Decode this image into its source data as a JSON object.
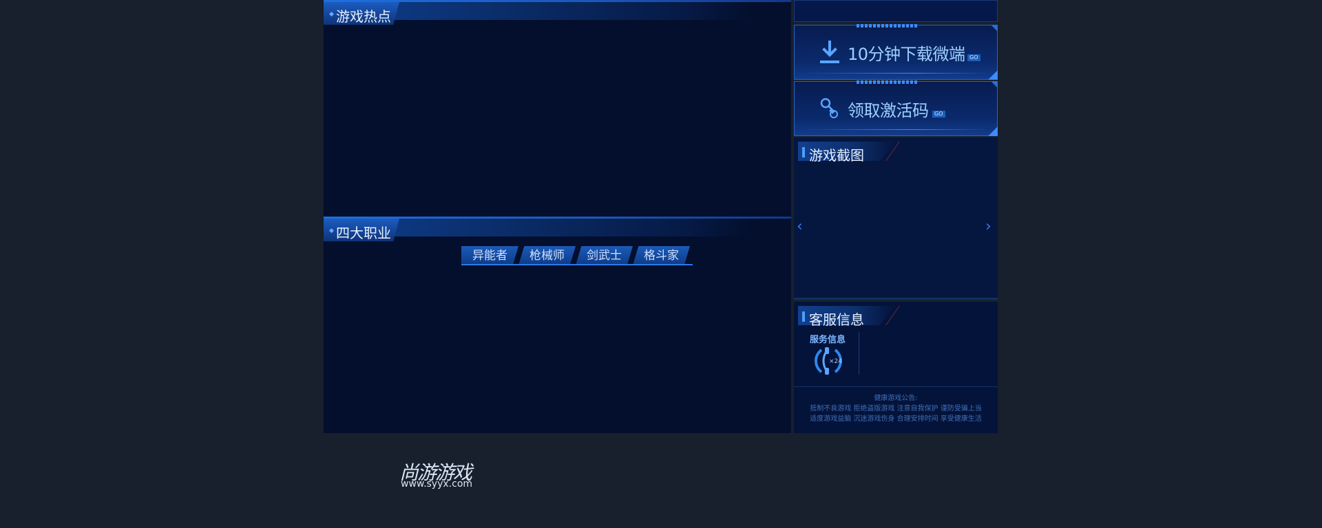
{
  "sections": {
    "hot": {
      "title": "游戏热点"
    },
    "classes": {
      "title": "四大职业",
      "tabs": [
        "异能者",
        "枪械师",
        "剑武士",
        "格斗家"
      ]
    }
  },
  "promos": {
    "download": {
      "label": "10分钟下载微端",
      "icon": "download-icon",
      "go": "GO"
    },
    "code": {
      "label": "领取激活码",
      "icon": "key-icon",
      "go": "GO"
    }
  },
  "gallery": {
    "title": "游戏截图",
    "prev_icon": "chevron-left-icon",
    "next_icon": "chevron-right-icon"
  },
  "service": {
    "title": "客服信息",
    "subtitle": "服务信息",
    "icon": "phone-24h-icon",
    "icon_text": "×24",
    "notice": [
      "健康游戏公告:",
      "抵制不良游戏  拒绝盗版游戏  注意自我保护  谨防受骗上当",
      "适度游戏益脑  沉迷游戏伤身  合理安排时间  享受健康生活"
    ]
  },
  "logo": {
    "name": "尚游游戏",
    "url": "www.syyx.com"
  },
  "colors": {
    "background": "#17202c",
    "panel": "#030f2d",
    "accent": "#3d8bff"
  }
}
